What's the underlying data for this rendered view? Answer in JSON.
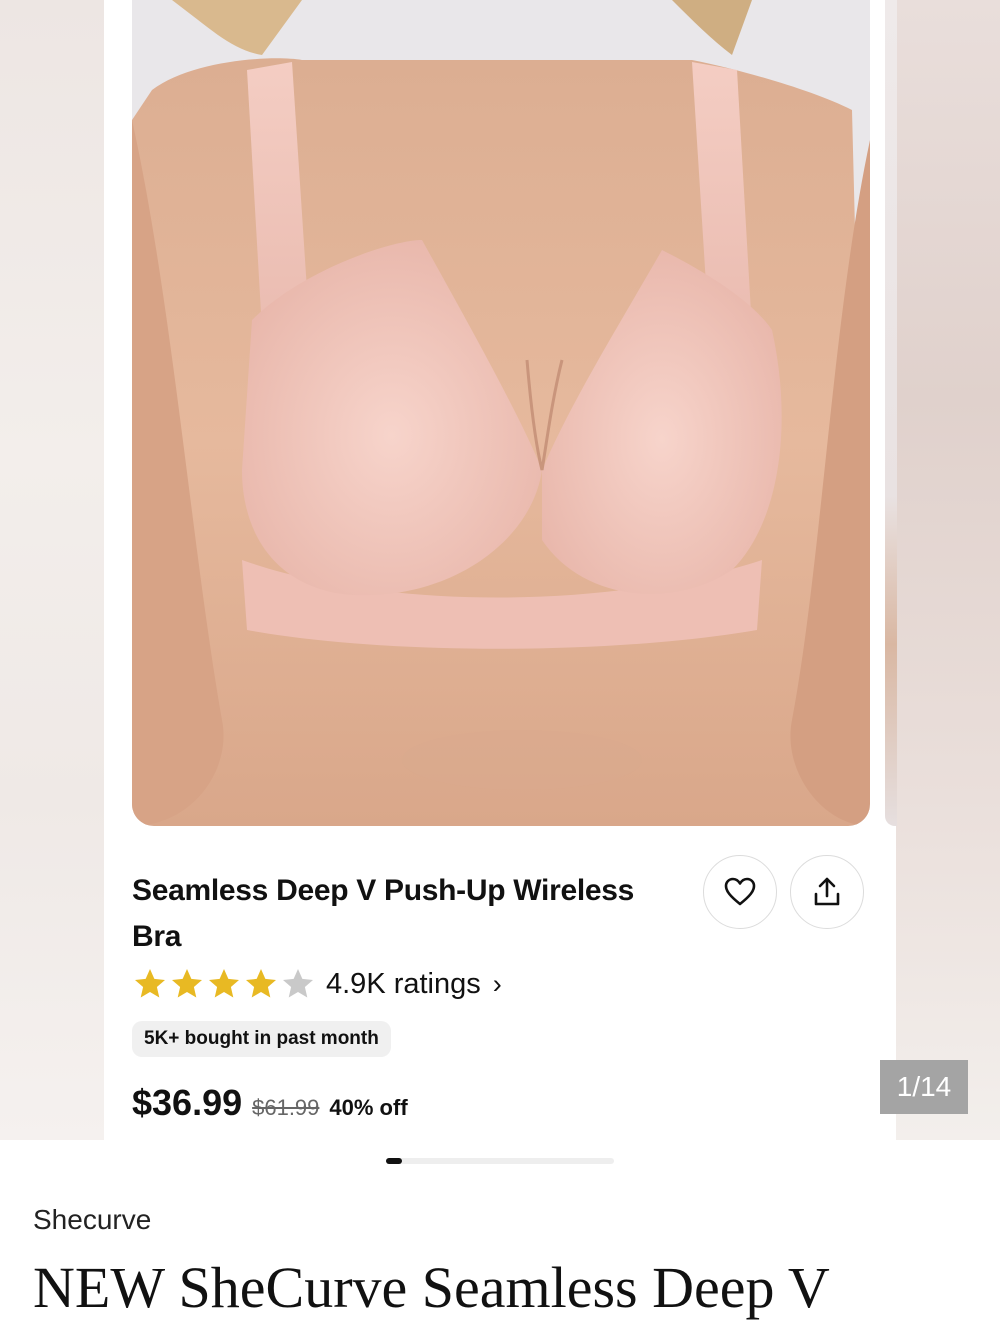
{
  "product_card": {
    "title": "Seamless Deep V Push-Up Wireless Bra",
    "rating": {
      "stars": 4,
      "max_stars": 5,
      "ratings_text": "4.9K ratings",
      "chevron": "›"
    },
    "bought_badge": "5K+ bought in past month",
    "price": "$36.99",
    "original_price": "$61.99",
    "discount": "40% off",
    "icons": {
      "favorite": "heart-icon",
      "share": "share-icon"
    },
    "colors": {
      "star_filled": "#E8B923",
      "star_empty": "#C9C9C9",
      "bra": "#F1C6BC"
    }
  },
  "carousel": {
    "counter": "1/14",
    "progress": 0.07
  },
  "listing": {
    "seller": "Shecurve",
    "title": "NEW SheCurve Seamless Deep V"
  }
}
